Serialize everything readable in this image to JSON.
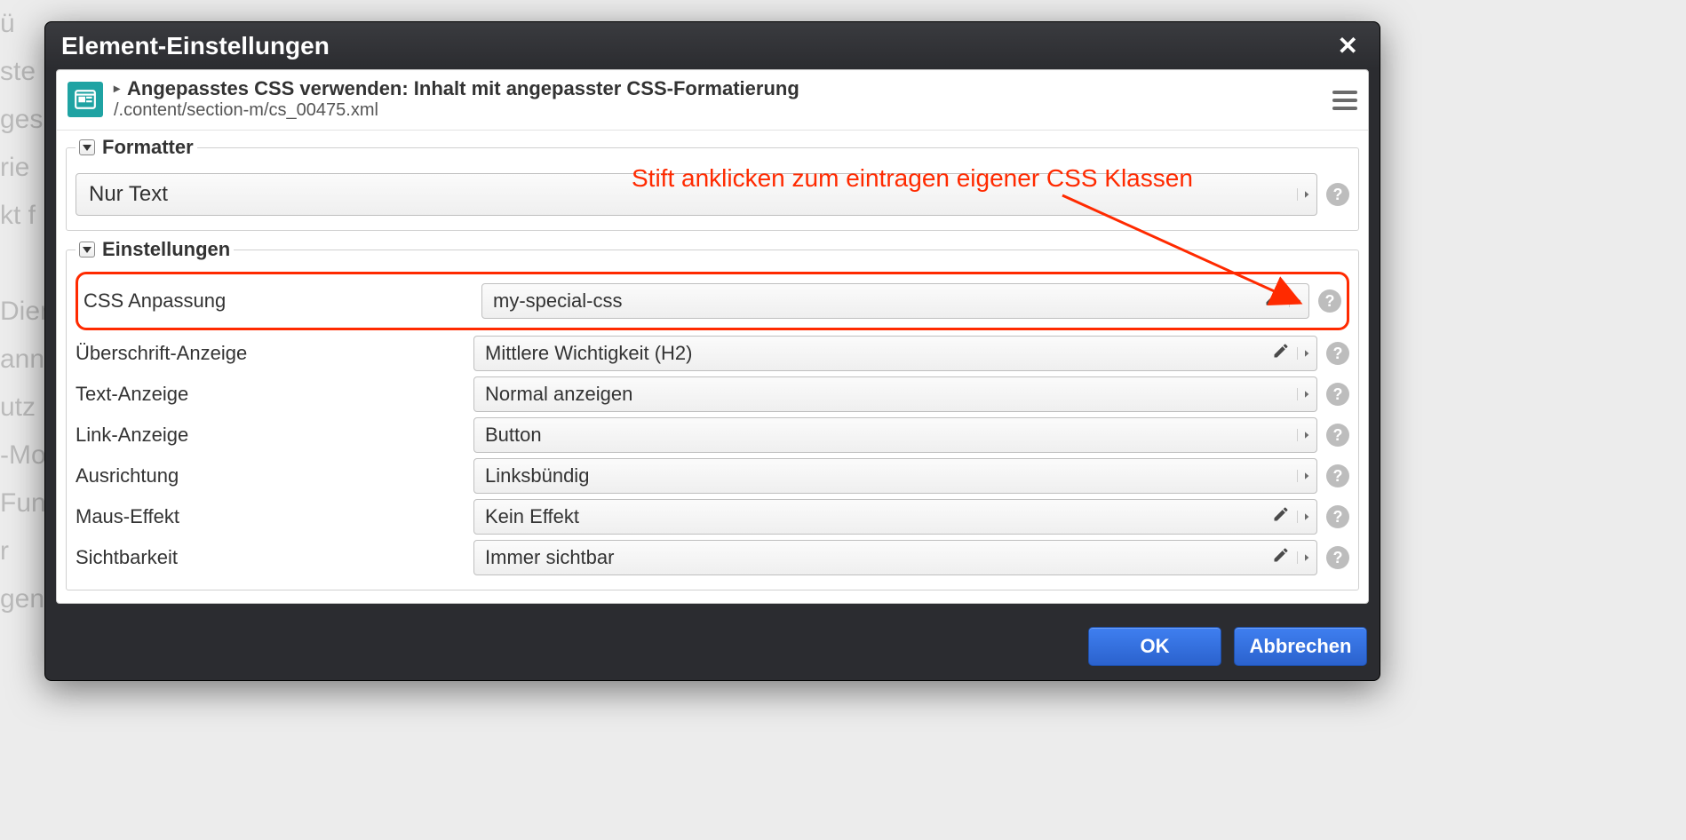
{
  "background_lines": "ü\nste\nges\nrie\nkt f\n\nDien\nann\nutz\n-Mo\nFun\nr\ngen",
  "dialog": {
    "title": "Element-Einstellungen",
    "resource": {
      "title_caret": "▸",
      "title": "Angepasstes CSS verwenden: Inhalt mit angepasster CSS-Formatierung",
      "path": "/.content/section-m/cs_00475.xml"
    },
    "annotation_text": "Stift anklicken zum eintragen eigener CSS Klassen",
    "sections": {
      "formatter": {
        "legend": "Formatter",
        "value": "Nur Text"
      },
      "settings": {
        "legend": "Einstellungen",
        "rows": [
          {
            "label": "CSS Anpassung",
            "value": "my-special-css",
            "editable": true,
            "highlight": true
          },
          {
            "label": "Überschrift-Anzeige",
            "value": "Mittlere Wichtigkeit (H2)",
            "editable": true,
            "highlight": false
          },
          {
            "label": "Text-Anzeige",
            "value": "Normal anzeigen",
            "editable": false,
            "highlight": false
          },
          {
            "label": "Link-Anzeige",
            "value": "Button",
            "editable": false,
            "highlight": false
          },
          {
            "label": "Ausrichtung",
            "value": "Linksbündig",
            "editable": false,
            "highlight": false
          },
          {
            "label": "Maus-Effekt",
            "value": "Kein Effekt",
            "editable": true,
            "highlight": false
          },
          {
            "label": "Sichtbarkeit",
            "value": "Immer sichtbar",
            "editable": true,
            "highlight": false
          }
        ]
      }
    },
    "buttons": {
      "ok": "OK",
      "cancel": "Abbrechen"
    }
  }
}
